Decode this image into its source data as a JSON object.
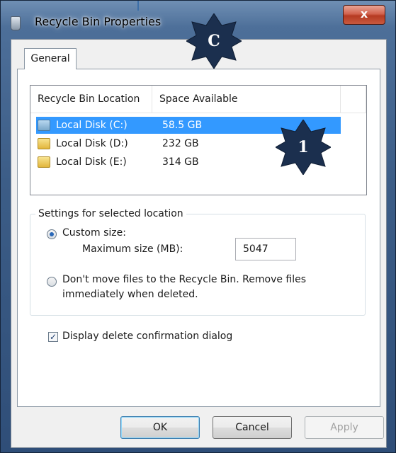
{
  "window": {
    "title": "Recycle Bin Properties",
    "close_label": "x"
  },
  "tabs": [
    {
      "label": "General"
    }
  ],
  "listview": {
    "columns": [
      "Recycle Bin Location",
      "Space Available"
    ],
    "rows": [
      {
        "location": "Local Disk (C:)",
        "space": "58.5 GB",
        "selected": true
      },
      {
        "location": "Local Disk (D:)",
        "space": "232 GB",
        "selected": false
      },
      {
        "location": "Local Disk (E:)",
        "space": "314 GB",
        "selected": false
      }
    ]
  },
  "settings": {
    "group_title": "Settings for selected location",
    "custom_size_label": "Custom size:",
    "max_size_label": "Maximum size (MB):",
    "max_size_value": "5047",
    "dont_move_line1": "Don't move files to the Recycle Bin. Remove files",
    "dont_move_line2": "immediately when deleted."
  },
  "confirm": {
    "label": "Display delete confirmation dialog",
    "checked": true
  },
  "buttons": {
    "ok": "OK",
    "cancel": "Cancel",
    "apply": "Apply"
  },
  "annotations": {
    "badge_c": "C",
    "badge_1": "1"
  },
  "colors": {
    "selection": "#3399ff",
    "badge": "#1b2f4e",
    "titlebar": "#4d6f99"
  },
  "icons": {
    "title": "recycle-bin-icon",
    "drive": "folder-icon"
  }
}
